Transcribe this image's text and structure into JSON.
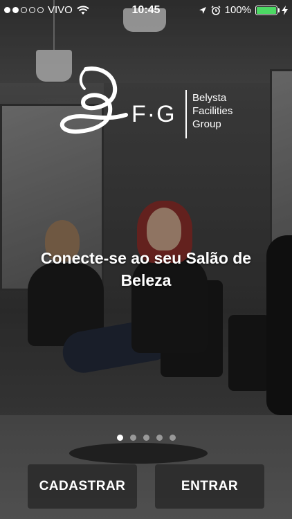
{
  "status_bar": {
    "carrier": "VIVO",
    "time": "10:45",
    "battery_percent": "100%",
    "signal_bars_filled": 2,
    "signal_bars_total": 5,
    "battery_color": "#4cd964"
  },
  "logo": {
    "monogram": "F·G",
    "brand_lines": [
      "Belysta",
      "Facilities",
      "Group"
    ]
  },
  "headline": "Conecte-se ao seu Salão de Beleza",
  "pager": {
    "pages": 5,
    "active_index": 0
  },
  "buttons": {
    "signup_label": "CADASTRAR",
    "login_label": "ENTRAR"
  }
}
